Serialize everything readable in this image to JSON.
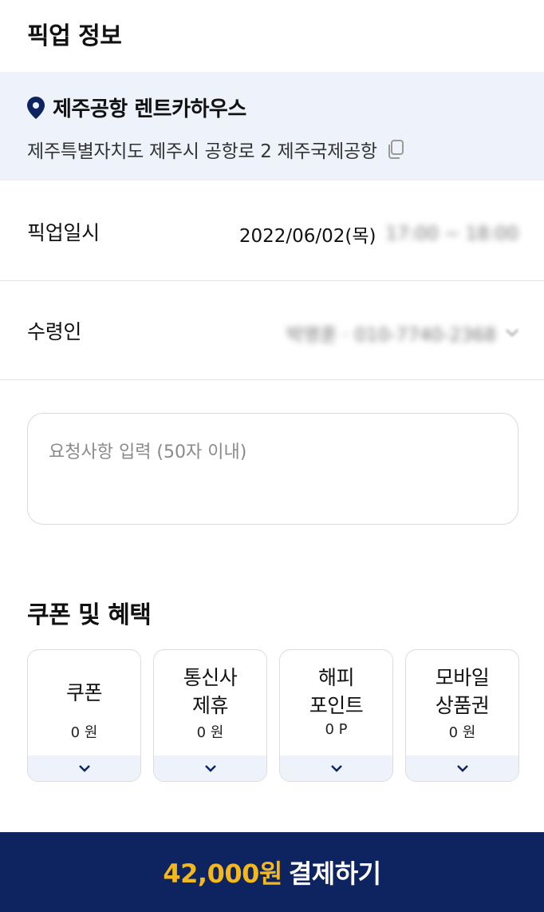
{
  "pickup": {
    "title": "픽업 정보",
    "location": {
      "name": "제주공항 렌트카하우스",
      "address": "제주특별자치도 제주시 공항로 2 제주국제공항",
      "pin_color": "#0d2461"
    },
    "datetime": {
      "label": "픽업일시",
      "date": "2022/06/02(목)",
      "time_range": "17:00 ~ 18:00"
    },
    "receiver": {
      "label": "수령인",
      "value": "박명훈 · 010-7740-2368"
    },
    "request": {
      "placeholder": "요청사항 입력 (50자 이내)",
      "value": ""
    }
  },
  "benefits": {
    "title": "쿠폰 및 혜택",
    "cards": [
      {
        "label_line1": "쿠폰",
        "label_line2": "",
        "value": "0 원"
      },
      {
        "label_line1": "통신사",
        "label_line2": "제휴",
        "value": "0 원"
      },
      {
        "label_line1": "해피",
        "label_line2": "포인트",
        "value": "0 P"
      },
      {
        "label_line1": "모바일",
        "label_line2": "상품권",
        "value": "0 원"
      }
    ]
  },
  "payment": {
    "amount": "42,000원",
    "label": "결제하기",
    "bar_color": "#0d2461",
    "amount_color": "#f5b81c"
  },
  "icons": {
    "location": "map-pin-icon",
    "copy": "copy-icon",
    "dropdown": "chevron-down-icon"
  }
}
